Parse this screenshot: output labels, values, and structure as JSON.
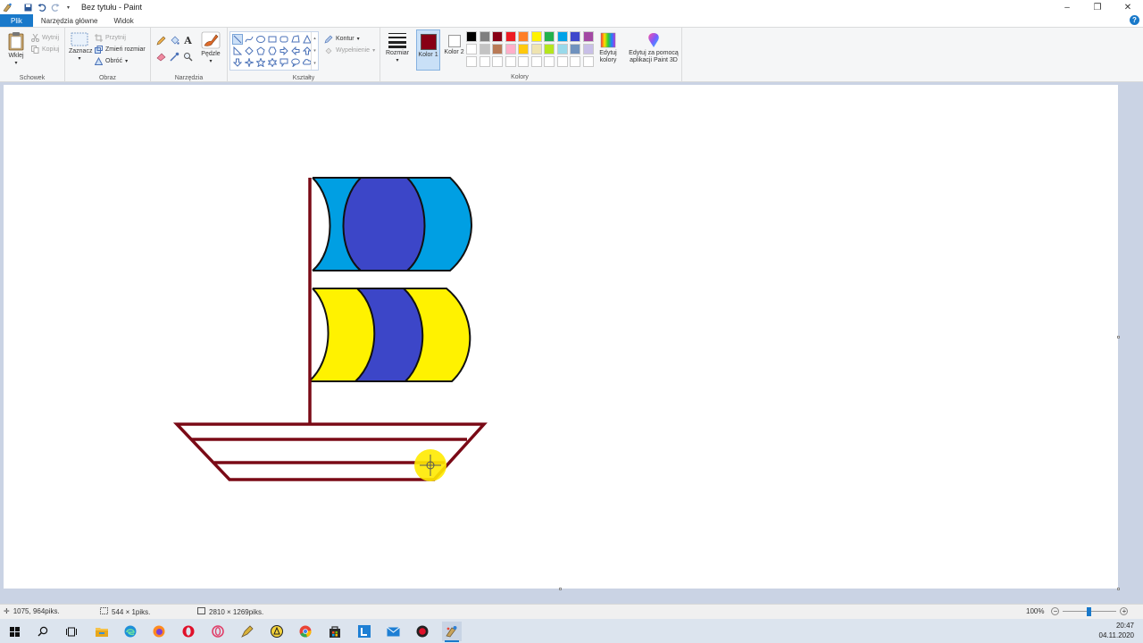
{
  "window": {
    "title": "Bez tytułu - Paint",
    "controls": {
      "minimize": "–",
      "restore": "❐",
      "close": "✕"
    }
  },
  "quick_access": [
    "paint-app-icon",
    "save-icon",
    "undo-icon",
    "redo-icon",
    "customize-dropdown-icon"
  ],
  "tabs": [
    {
      "label": "Plik",
      "active": true
    },
    {
      "label": "Narzędzia główne",
      "active": false
    },
    {
      "label": "Widok",
      "active": false
    }
  ],
  "ribbon": {
    "clipboard": {
      "group_label": "Schowek",
      "paste_label": "Wklej",
      "cut_label": "Wytnij",
      "copy_label": "Kopiuj"
    },
    "image": {
      "group_label": "Obraz",
      "select_label": "Zaznacz",
      "crop_label": "Przytnij",
      "resize_label": "Zmień rozmiar",
      "rotate_label": "Obróć"
    },
    "tools": {
      "group_label": "Narzędzia",
      "brushes_label": "Pędzle"
    },
    "shapes": {
      "group_label": "Kształty",
      "outline_label": "Kontur",
      "fill_label": "Wypełnienie"
    },
    "size": {
      "label": "Rozmiar"
    },
    "colors": {
      "group_label": "Kolory",
      "color1_label": "Kolor 1",
      "color2_label": "Kolor 2",
      "color1": "#880015",
      "color2": "#ffffff",
      "edit_colors_label": "Edytuj kolory",
      "paint3d_label": "Edytuj za pomocą aplikacji Paint 3D",
      "palette_row1": [
        "#000000",
        "#7f7f7f",
        "#880015",
        "#ed1c24",
        "#ff7f27",
        "#fff200",
        "#22b14c",
        "#00a2e8",
        "#3f48cc",
        "#a349a4"
      ],
      "palette_row2": [
        "#ffffff",
        "#c3c3c3",
        "#b97a57",
        "#ffaec9",
        "#ffc90e",
        "#efe4b0",
        "#b5e61d",
        "#99d9ea",
        "#7092be",
        "#c8bfe7"
      ]
    }
  },
  "drawing": {
    "outline_color": "#7a0a16",
    "sail_blue_light": "#009fe3",
    "sail_blue_dark": "#3c46c8",
    "sail_yellow": "#fff200",
    "cursor_highlight": "#ffea00"
  },
  "status": {
    "cursor_pos": "1075, 964piks.",
    "selection_size": "544 × 1piks.",
    "image_size": "2810 × 1269piks.",
    "zoom": "100%"
  },
  "taskbar": {
    "apps": [
      "windows-start-icon",
      "search-icon",
      "task-view-icon",
      "file-explorer-icon",
      "edge-icon",
      "firefox-icon",
      "opera-icon",
      "opera-gx-icon",
      "sketch-icon",
      "archicad-icon",
      "chrome-icon",
      "store-icon",
      "l-app-icon",
      "mail-icon",
      "record-icon",
      "paint-icon"
    ],
    "time": "20:47",
    "date": "04.11.2020"
  }
}
